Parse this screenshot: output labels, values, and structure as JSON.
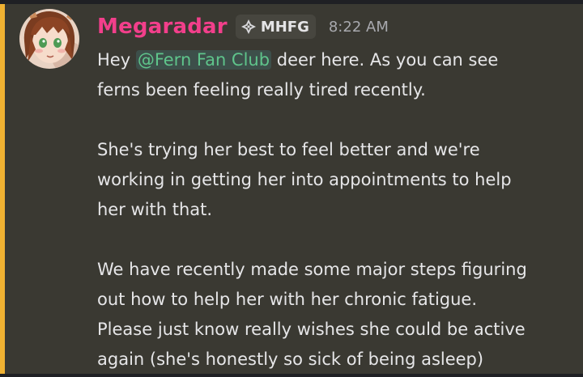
{
  "message": {
    "author": "Megaradar",
    "server_tag": "MHFG",
    "server_tag_icon": "diamond-cross-icon",
    "timestamp": "8:22 AM",
    "mention": "@Fern Fan Club",
    "lines": {
      "l1_before": "Hey ",
      "l1_after": " deer here. As you can see",
      "l2": "ferns been feeling really tired recently.",
      "l3": "She's trying her best to feel better and we're",
      "l4": "working in getting her into appointments to help",
      "l5": "her with that.",
      "l6": "We have recently made some major steps figuring",
      "l7": "out how to help her with her chronic fatigue.",
      "l8": "Please just know really wishes she could be active",
      "l9": "again (she's honestly so sick of being asleep)"
    }
  },
  "colors": {
    "username": "#f23f8b",
    "mention_text": "#5fc48b",
    "mention_bg": "#3d4f4a",
    "highlight_bar": "#f0b232",
    "message_bg": "#3a3932"
  }
}
